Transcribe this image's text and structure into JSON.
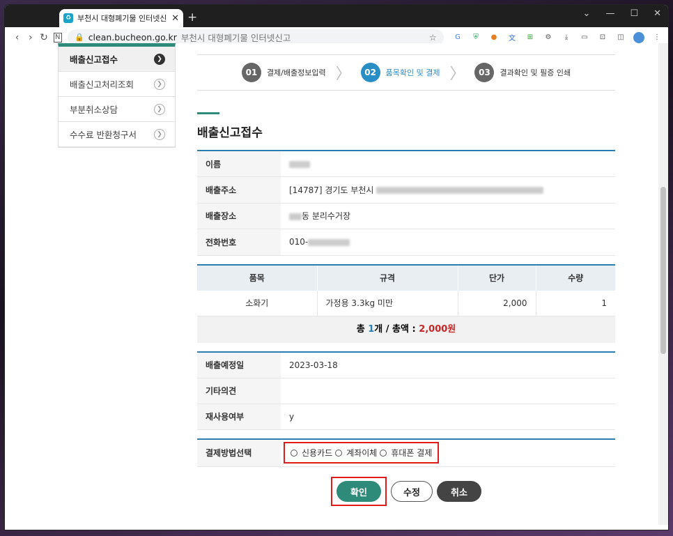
{
  "browser": {
    "tab_title": "부천시 대형폐기물 인터넷신",
    "url_host": "clean.bucheon.go.kr",
    "url_title": "부천시 대형폐기물 인터넷신고"
  },
  "sidebar": {
    "items": [
      {
        "label": "배출신고접수"
      },
      {
        "label": "배출신고처리조회"
      },
      {
        "label": "부분취소상담"
      },
      {
        "label": "수수료 반환청구서"
      }
    ]
  },
  "steps": [
    {
      "num": "01",
      "label": "결제/배출정보입력"
    },
    {
      "num": "02",
      "label": "품목확인 및 결제"
    },
    {
      "num": "03",
      "label": "결과확인 및 필증 인쇄"
    }
  ],
  "section_title": "배출신고접수",
  "info": {
    "name_label": "이름",
    "address_label": "배출주소",
    "address_prefix": "[14787] 경기도 부천시",
    "place_label": "배출장소",
    "place_value": "동 분리수거장",
    "phone_label": "전화번호",
    "phone_prefix": "010-"
  },
  "items_table": {
    "headers": [
      "품목",
      "규격",
      "단가",
      "수량"
    ],
    "rows": [
      {
        "item": "소화기",
        "spec": "가정용 3.3kg 미만",
        "price": "2,000",
        "qty": "1"
      }
    ],
    "total_prefix": "총 ",
    "total_count": "1",
    "total_mid": "개 / 총액 : ",
    "total_amount": "2,000원"
  },
  "extra": {
    "date_label": "배출예정일",
    "date_value": "2023-03-18",
    "memo_label": "기타의견",
    "reuse_label": "재사용여부",
    "reuse_value": "y"
  },
  "payment": {
    "label": "결제방법선택",
    "options": [
      "신용카드",
      "계좌이체",
      "휴대폰 결제"
    ]
  },
  "buttons": {
    "confirm": "확인",
    "edit": "수정",
    "cancel": "취소"
  }
}
